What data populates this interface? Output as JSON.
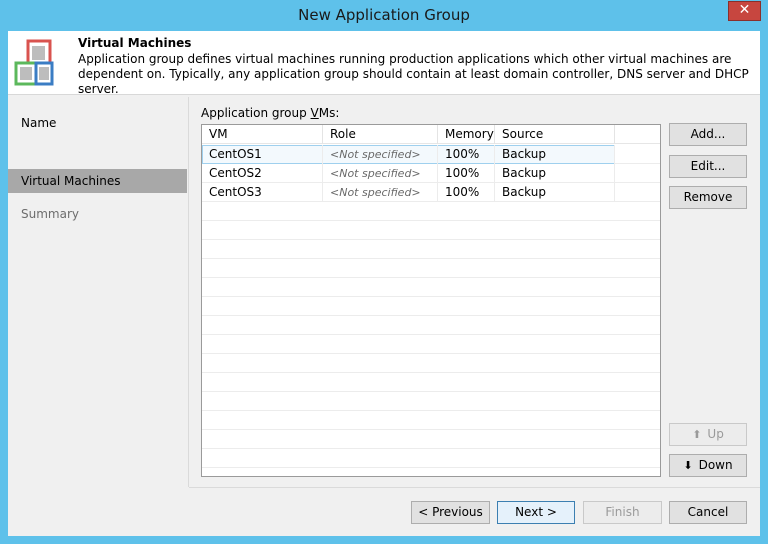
{
  "window": {
    "title": "New Application Group",
    "close_label": "✕"
  },
  "header": {
    "title": "Virtual Machines",
    "description": "Application group defines virtual machines running production applications which other virtual machines are dependent on. Typically, any application group should contain at least domain controller, DNS server and DHCP server."
  },
  "sidebar": {
    "items": [
      {
        "label": "Name",
        "state": "normal"
      },
      {
        "label": "Virtual Machines",
        "state": "active"
      },
      {
        "label": "Summary",
        "state": "disabled"
      }
    ]
  },
  "vm_list": {
    "label_prefix": "Application group ",
    "label_accel": "V",
    "label_suffix": "Ms:",
    "columns": [
      "VM",
      "Role",
      "Memory",
      "Source"
    ],
    "rows": [
      {
        "vm": "CentOS1",
        "role": "<Not specified>",
        "memory": "100%",
        "source": "Backup",
        "selected": true
      },
      {
        "vm": "CentOS2",
        "role": "<Not specified>",
        "memory": "100%",
        "source": "Backup",
        "selected": false
      },
      {
        "vm": "CentOS3",
        "role": "<Not specified>",
        "memory": "100%",
        "source": "Backup",
        "selected": false
      }
    ]
  },
  "side_buttons": {
    "add": "Add...",
    "edit": "Edit...",
    "remove": "Remove",
    "up": "Up",
    "down": "Down"
  },
  "footer": {
    "previous": "< Previous",
    "next": "Next >",
    "finish": "Finish",
    "cancel": "Cancel"
  },
  "colors": {
    "title_bar": "#5ec1ea",
    "close_button": "#c7463f",
    "selected_nav": "#a8a8a8"
  }
}
